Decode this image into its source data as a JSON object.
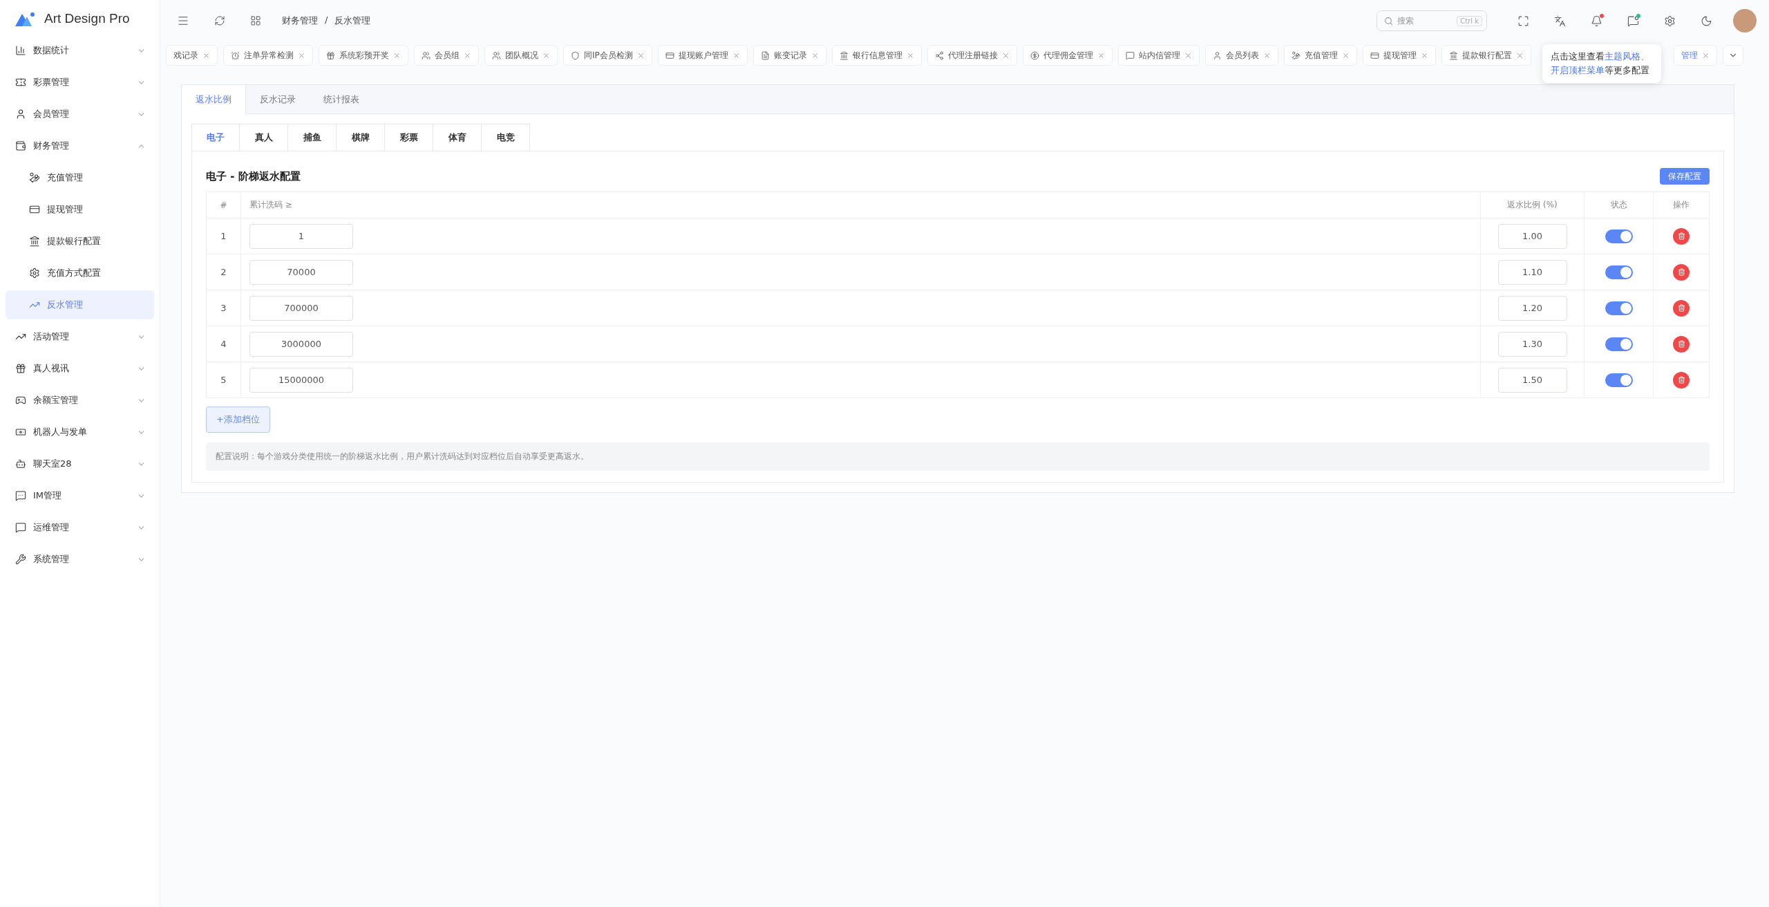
{
  "app": {
    "title": "Art Design Pro"
  },
  "sidebar": {
    "items": [
      {
        "label": "数据统计",
        "expanded": false
      },
      {
        "label": "彩票管理",
        "expanded": false
      },
      {
        "label": "会员管理",
        "expanded": false
      },
      {
        "label": "财务管理",
        "expanded": true,
        "children": [
          {
            "label": "充值管理",
            "selected": false
          },
          {
            "label": "提现管理",
            "selected": false
          },
          {
            "label": "提款银行配置",
            "selected": false
          },
          {
            "label": "充值方式配置",
            "selected": false
          },
          {
            "label": "反水管理",
            "selected": true
          }
        ]
      },
      {
        "label": "活动管理",
        "expanded": false
      },
      {
        "label": "真人视讯",
        "expanded": false
      },
      {
        "label": "余额宝管理",
        "expanded": false
      },
      {
        "label": "机器人与发单",
        "expanded": false
      },
      {
        "label": "聊天室28",
        "expanded": false
      },
      {
        "label": "IM管理",
        "expanded": false
      },
      {
        "label": "运维管理",
        "expanded": false
      },
      {
        "label": "系统管理",
        "expanded": false
      }
    ]
  },
  "topbar": {
    "breadcrumb": {
      "items": [
        "财务管理",
        "反水管理"
      ],
      "separator": "/"
    },
    "search": {
      "placeholder": "搜索",
      "shortcut": "Ctrl k"
    },
    "notifications_unread": true,
    "messages_unread": true
  },
  "tags": [
    {
      "label": "戏记录",
      "selected": false
    },
    {
      "label": "注单异常检测",
      "selected": false
    },
    {
      "label": "系统彩预开奖",
      "selected": false
    },
    {
      "label": "会员组",
      "selected": false
    },
    {
      "label": "团队概况",
      "selected": false
    },
    {
      "label": "同IP会员检测",
      "selected": false
    },
    {
      "label": "提现账户管理",
      "selected": false
    },
    {
      "label": "账变记录",
      "selected": false
    },
    {
      "label": "银行信息管理",
      "selected": false
    },
    {
      "label": "代理注册链接",
      "selected": false
    },
    {
      "label": "代理佣金管理",
      "selected": false
    },
    {
      "label": "站内信管理",
      "selected": false
    },
    {
      "label": "会员列表",
      "selected": false
    },
    {
      "label": "充值管理",
      "selected": false
    },
    {
      "label": "提现管理",
      "selected": false
    },
    {
      "label": "提款银行配置",
      "selected": false
    },
    {
      "label": "管理",
      "selected": true
    }
  ],
  "tooltip": {
    "parts": [
      {
        "text": "点击这里查看",
        "link": false
      },
      {
        "text": "主题风格、",
        "link": true
      },
      {
        "text": "开启顶栏菜单",
        "link": true
      },
      {
        "text": "等更多配置",
        "link": false
      }
    ]
  },
  "page_tabs": [
    {
      "label": "返水比例",
      "selected": true
    },
    {
      "label": "反水记录",
      "selected": false
    },
    {
      "label": "统计报表",
      "selected": false
    }
  ],
  "category_tabs": [
    {
      "label": "电子",
      "selected": true
    },
    {
      "label": "真人",
      "selected": false
    },
    {
      "label": "捕鱼",
      "selected": false
    },
    {
      "label": "棋牌",
      "selected": false
    },
    {
      "label": "彩票",
      "selected": false
    },
    {
      "label": "体育",
      "selected": false
    },
    {
      "label": "电竞",
      "selected": false
    }
  ],
  "section": {
    "title": "电子 - 阶梯返水配置",
    "save_button": "保存配置"
  },
  "table": {
    "columns": [
      "#",
      "累计洗码 ≥",
      "返水比例 (%)",
      "状态",
      "操作"
    ],
    "rows": [
      {
        "index": "1",
        "threshold": "1",
        "rate": "1.00",
        "enabled": true
      },
      {
        "index": "2",
        "threshold": "70000",
        "rate": "1.10",
        "enabled": true
      },
      {
        "index": "3",
        "threshold": "700000",
        "rate": "1.20",
        "enabled": true
      },
      {
        "index": "4",
        "threshold": "3000000",
        "rate": "1.30",
        "enabled": true
      },
      {
        "index": "5",
        "threshold": "15000000",
        "rate": "1.50",
        "enabled": true
      }
    ]
  },
  "add_button": "+添加档位",
  "note": "配置说明：每个游戏分类使用统一的阶梯返水比例，用户累计洗码达到对应档位后自动享受更高返水。"
}
